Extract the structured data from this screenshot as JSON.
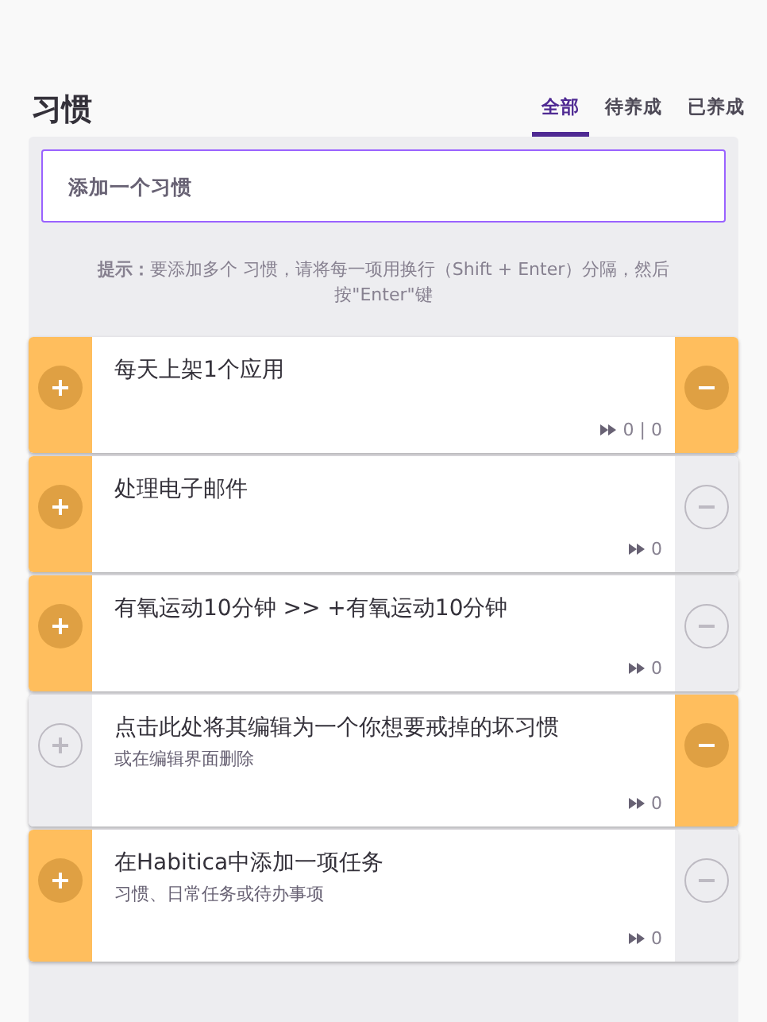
{
  "header": {
    "title": "习惯"
  },
  "tabs": [
    {
      "label": "全部",
      "selected": true
    },
    {
      "label": "待养成",
      "selected": false
    },
    {
      "label": "已养成",
      "selected": false
    }
  ],
  "add_field": {
    "placeholder": "添加一个习惯"
  },
  "hint": "**提示：**要添加多个 习惯，请将每一项用换行（Shift + Enter）分隔，然后按\"Enter\"键",
  "habits": [
    {
      "title": "每天上架1个应用",
      "up_enabled": true,
      "down_enabled": true,
      "counter": "0 | 0"
    },
    {
      "title": "处理电子邮件",
      "up_enabled": true,
      "down_enabled": false,
      "counter": "0"
    },
    {
      "title": "有氧运动10分钟 >> +有氧运动10分钟",
      "up_enabled": true,
      "down_enabled": false,
      "counter": "0"
    },
    {
      "title": "点击此处将其编辑为一个你想要戒掉的坏习惯",
      "notes": "或在编辑界面删除",
      "up_enabled": false,
      "down_enabled": true,
      "counter": "0"
    },
    {
      "title": "在Habitica中添加一项任务",
      "notes": "习惯、日常任务或待办事项",
      "up_enabled": true,
      "down_enabled": false,
      "counter": "0"
    }
  ]
}
